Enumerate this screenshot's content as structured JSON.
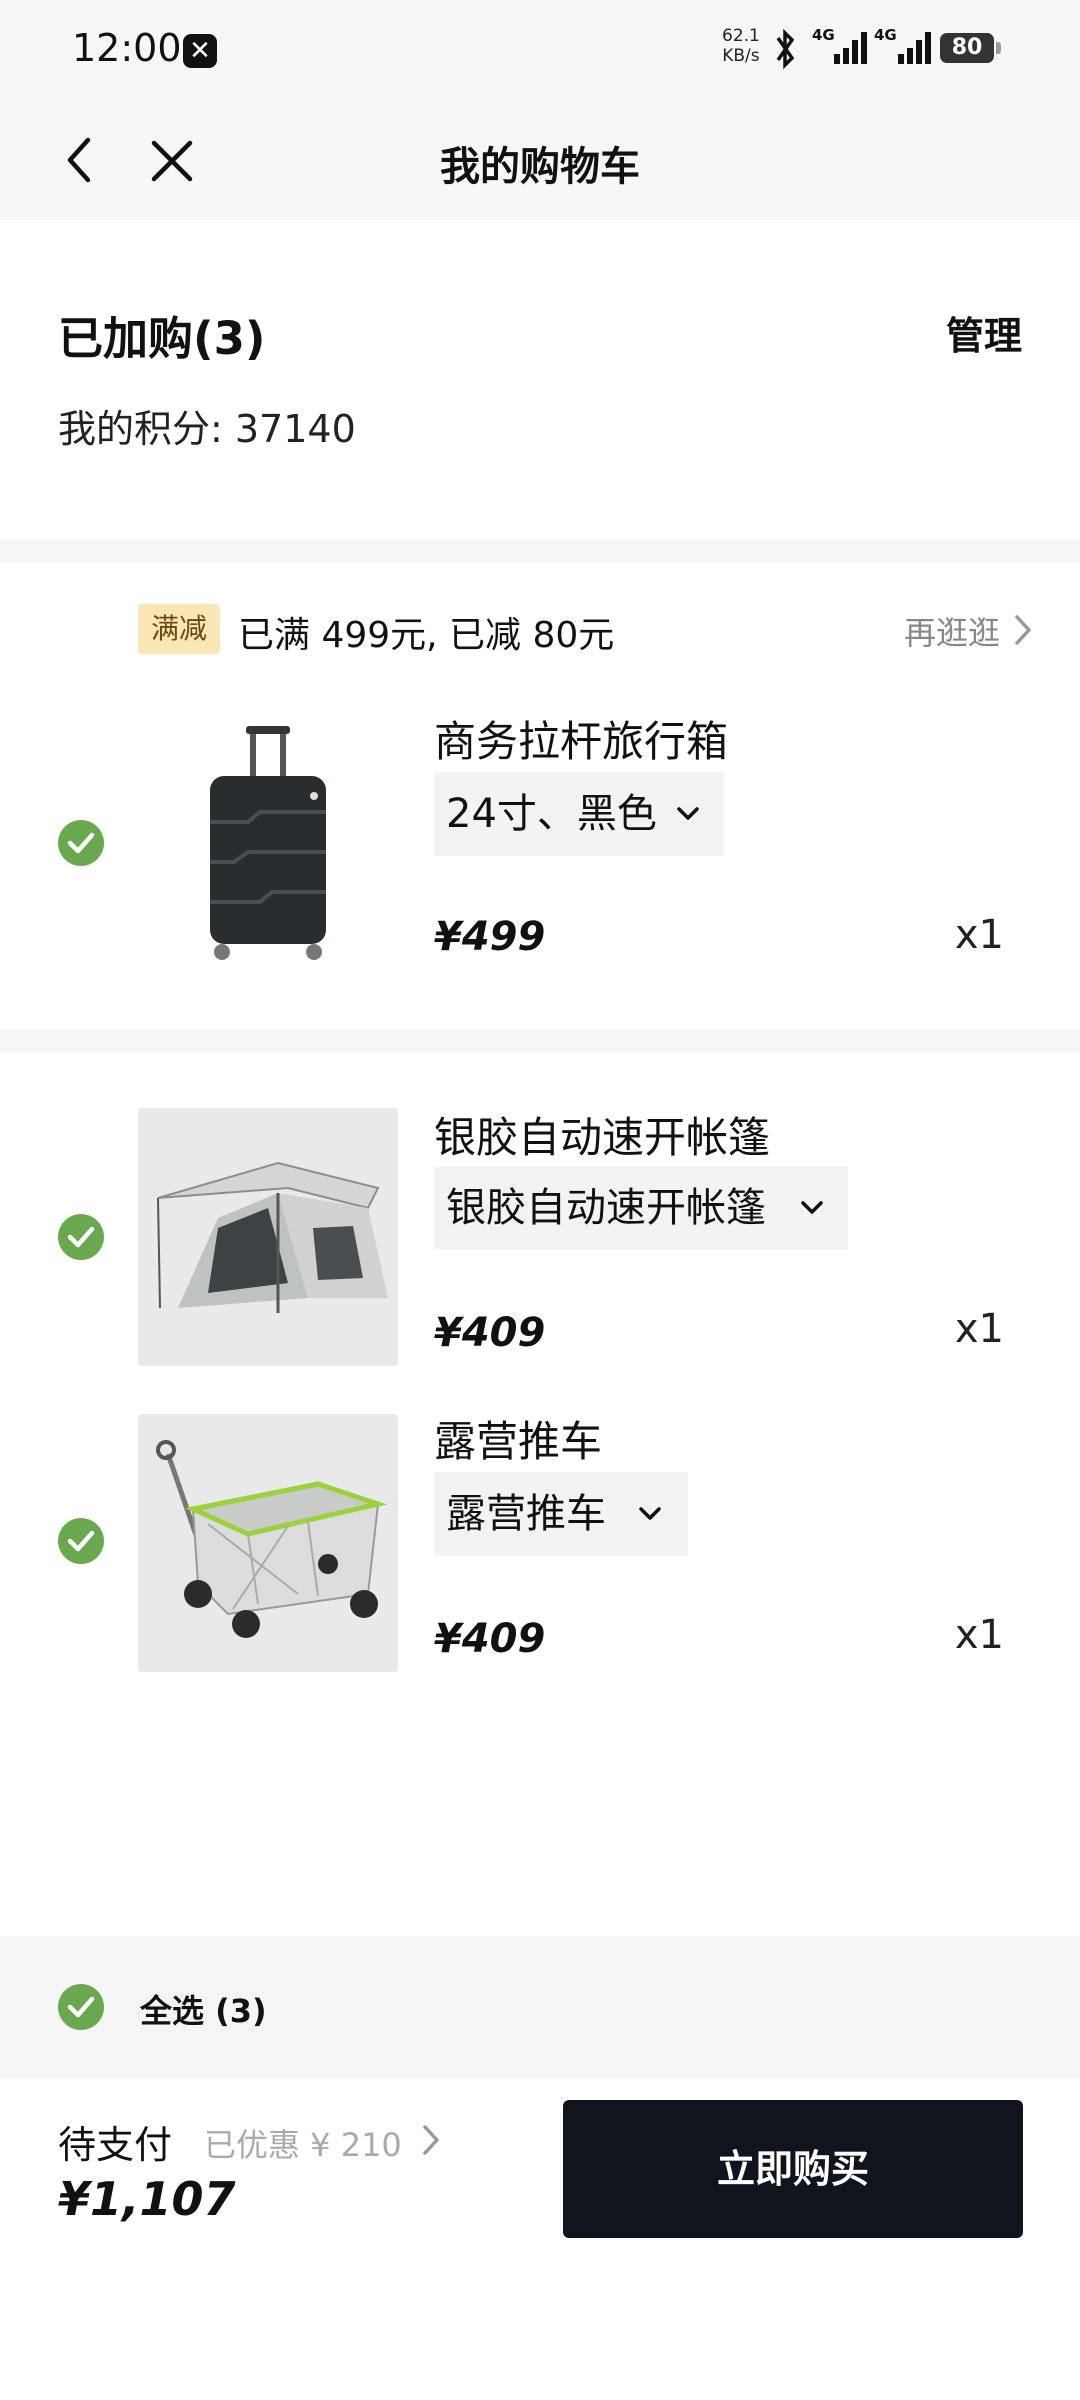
{
  "status_bar": {
    "time": "12:00",
    "net_speed_value": "62.1",
    "net_speed_unit": "KB/s",
    "signal1": "4G",
    "signal2": "4G",
    "battery": "80"
  },
  "nav": {
    "title": "我的购物车"
  },
  "header": {
    "added_label": "已加购(3)",
    "manage_label": "管理",
    "points_text": "我的积分: 37140"
  },
  "promo": {
    "tag": "满减",
    "text": "已满 499元, 已减 80元",
    "more": "再逛逛"
  },
  "items": [
    {
      "name": "商务拉杆旅行箱",
      "variant": "24寸、黑色",
      "price": "¥499",
      "qty": "x1",
      "selected": true,
      "image": "luggage"
    },
    {
      "name": "银胶自动速开帐篷",
      "variant": "银胶自动速开帐篷",
      "price": "¥409",
      "qty": "x1",
      "selected": true,
      "image": "tent"
    },
    {
      "name": "露营推车",
      "variant": "露营推车",
      "price": "¥409",
      "qty": "x1",
      "selected": true,
      "image": "wagon"
    }
  ],
  "footer": {
    "select_all": "全选 (3)",
    "pending_label": "待支付",
    "discount": "已优惠 ¥ 210",
    "total": "¥1,107",
    "buy_label": "立即购买"
  },
  "colors": {
    "check": "#6aa84f",
    "buy_button": "#0f141d",
    "promo_tag_bg": "#fbe6b6"
  }
}
